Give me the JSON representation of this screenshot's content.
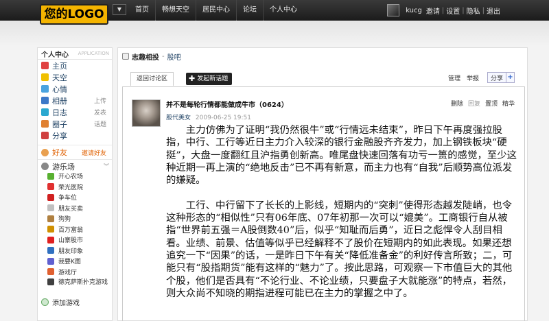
{
  "logo": {
    "text": "您的LOGO"
  },
  "topnav": [
    "首页",
    "畅想天空",
    "居民中心",
    "论坛",
    "个人中心"
  ],
  "user": {
    "name": "kucg",
    "links": [
      "邀请",
      "设置",
      "隐私",
      "退出"
    ]
  },
  "sidebar": {
    "title": "个人中心",
    "subtitle": "APPLICATION",
    "items": [
      {
        "label": "主页",
        "icon": "home-icon",
        "color": "#e04040"
      },
      {
        "label": "天空",
        "icon": "star-icon",
        "color": "#f0c000"
      },
      {
        "label": "心情",
        "icon": "mood-icon",
        "color": "#4aa3df"
      },
      {
        "label": "相册",
        "icon": "photo-icon",
        "color": "#3c78c8",
        "right": "上传"
      },
      {
        "label": "日志",
        "icon": "blog-icon",
        "color": "#2aa8d0",
        "right": "发表"
      },
      {
        "label": "圈子",
        "icon": "group-icon",
        "color": "#e08030",
        "right": "话题"
      },
      {
        "label": "分享",
        "icon": "share-icon",
        "color": "#d04040"
      }
    ],
    "friends": {
      "label": "好友",
      "action": "邀请好友",
      "color": "#e06000"
    },
    "games": {
      "title": "游乐场",
      "items": [
        {
          "label": "开心农场",
          "color": "#58b030"
        },
        {
          "label": "荣光医院",
          "color": "#e03030"
        },
        {
          "label": "争车位",
          "color": "#d02020"
        },
        {
          "label": "朋友买卖",
          "color": "#c0c0c0"
        },
        {
          "label": "狗狗",
          "color": "#b08040"
        },
        {
          "label": "百万富翁",
          "color": "#d09000"
        },
        {
          "label": "山寨股市",
          "color": "#e02020"
        },
        {
          "label": "朋友印象",
          "color": "#3070c0"
        },
        {
          "label": "我要K图",
          "color": "#6060d0"
        },
        {
          "label": "游戏厅",
          "color": "#e06030"
        },
        {
          "label": "德克萨斯扑克游戏",
          "color": "#404040"
        }
      ],
      "add_label": "添加游戏"
    }
  },
  "breadcrumb": {
    "group": "志趣相投",
    "forum": "股吧"
  },
  "tabs": {
    "back": "返回讨论区",
    "new_topic": "发起新话题"
  },
  "tools": {
    "manage": "管理",
    "report": "举报",
    "share": "分享"
  },
  "post": {
    "title": "并不是每轮行情都能做成牛市（0624）",
    "author": "股代美女",
    "time": "2009-06-25 19:51",
    "actions": [
      "删除",
      "回复",
      "置顶",
      "精华"
    ],
    "paragraphs": [
      "主力仿佛为了证明“我仍然很牛”或“行情远未结束”，昨日下午再度强拉股指，中行、工行等近日主力介入较深的银行金融股齐齐发力，加上钢铁板块“硬挺”，大盘一度翻红且沪指勇创新高。唯尾盘快速回落有功亏一篑的感觉，至少这种近期一再上演的“绝地反击”已不再有新意，而主力也有“自我”后顺势高位派发的嫌疑。",
      "工行、中行留下了长长的上影线，短期内的“突刺”使得形态越发陡峭，也令这种形态的“相似性”只有06年底、07年初那一次可以“媲美”。工商银行自从被指“世界前五强＝A股倒数40”后，似乎“知耻而后勇”，近日之彪悍令人刮目相看。业绩、前景、估值等似乎已经解释不了股价在短期内的如此表现。如果还想追究一下“因果”的话，一是昨日下午有关“降低准备金”的利好传言所致；二，可能只有“股指期货”能有这样的“魅力”了。按此思路，可观察一下市值巨大的其他个股，他们是否具有“不论行业、不论业绩，只要盘子大就能涨”的特点，若然，则大众尚不知晓的期指进程可能已在主力的掌握之中了。"
    ]
  }
}
